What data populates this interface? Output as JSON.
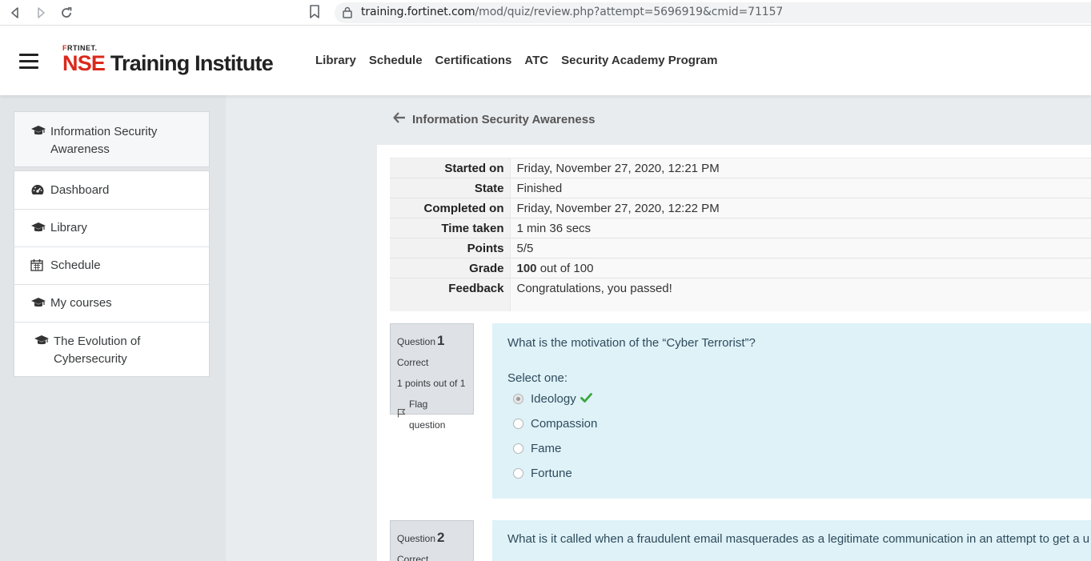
{
  "browser": {
    "url_host": "training.fortinet.com",
    "url_path": "/mod/quiz/review.php?attempt=5696919&cmid=71157"
  },
  "header": {
    "logo_small": "F",
    "logo_small_rest": "RTINET.",
    "logo_nse": "NSE",
    "logo_rest": " Training Institute",
    "nav": [
      "Library",
      "Schedule",
      "Certifications",
      "ATC",
      "Security Academy Program"
    ]
  },
  "sidebar": {
    "course": "Information Security Awareness",
    "items": [
      {
        "label": "Dashboard",
        "icon": "dashboard-icon"
      },
      {
        "label": "Library",
        "icon": "graduation-cap-icon"
      },
      {
        "label": "Schedule",
        "icon": "calendar-icon"
      },
      {
        "label": "My courses",
        "icon": "graduation-cap-icon"
      },
      {
        "label": "The Evolution of Cybersecurity",
        "icon": "graduation-cap-icon"
      }
    ]
  },
  "main": {
    "back_title": "Information Security Awareness",
    "summary": [
      {
        "label": "Started on",
        "value": "Friday, November 27, 2020, 12:21 PM"
      },
      {
        "label": "State",
        "value": "Finished"
      },
      {
        "label": "Completed on",
        "value": "Friday, November 27, 2020, 12:22 PM"
      },
      {
        "label": "Time taken",
        "value": "1 min 36 secs"
      },
      {
        "label": "Points",
        "value": "5/5"
      },
      {
        "label": "Grade",
        "value_bold": "100",
        "value": " out of 100"
      },
      {
        "label": "Feedback",
        "value": "Congratulations, you passed!"
      }
    ],
    "questions": [
      {
        "label": "Question",
        "number": "1",
        "state": "Correct",
        "points": "1 points out of 1",
        "flag": "Flag question",
        "text": "What is the motivation of the “Cyber Terrorist”?",
        "prompt": "Select one:",
        "answers": [
          "Ideology",
          "Compassion",
          "Fame",
          "Fortune"
        ],
        "selected_index": 0
      },
      {
        "label": "Question",
        "number": "2",
        "state": "Correct",
        "text": "What is it called when a fraudulent email masquerades as a legitimate communication in an attempt to get a u"
      }
    ]
  },
  "colors": {
    "brand_red": "#da291c",
    "question_bg": "#def2f8",
    "correct_green": "#3aa63a"
  }
}
